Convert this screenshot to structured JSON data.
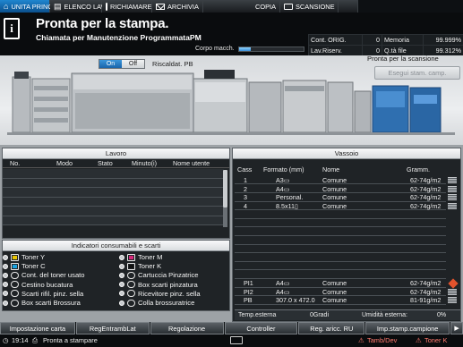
{
  "tabs": [
    {
      "label": "UNITA PRINC.",
      "icon": "home-icon",
      "active": true
    },
    {
      "label": "ELENCO LAV.",
      "icon": "job-list-icon"
    },
    {
      "label": "RICHIAMARE",
      "icon": "recall-icon"
    },
    {
      "label": "ARCHIVIA",
      "icon": "store-icon"
    },
    {
      "label": "COPIA",
      "icon": "copy-icon"
    },
    {
      "label": "SCANSIONE",
      "icon": "scan-icon"
    }
  ],
  "header": {
    "status": "Pronta per la stampa.",
    "substatus": "Chiamata per Manutenzione ProgrammataPM",
    "body_label": "Corpo macch.",
    "body_level": 0.18,
    "counters": [
      {
        "label": "Cont. ORIG.",
        "value": "0",
        "label2": "Memoria",
        "value2": "99.999%"
      },
      {
        "label": "Lav.Riserv.",
        "value": "0",
        "label2": "Q.tà file",
        "value2": "99.312%"
      }
    ]
  },
  "illustration": {
    "toggle_on": "On",
    "toggle_off": "Off",
    "heat_label": "Riscaldat. PB",
    "scan_ready": "Pronta per la scansione",
    "print_samples": "Esegui stam. camp."
  },
  "jobs": {
    "title": "Lavoro",
    "columns": [
      "No.",
      "Modo",
      "Stato",
      "Minuto(i)",
      "Nome utente"
    ],
    "rows": 6
  },
  "consumables": {
    "title": "Indicatori consumabili e scarti",
    "left": [
      {
        "label": "Toner Y",
        "icon": "toner-y-icon",
        "color": "#e8c400"
      },
      {
        "label": "Toner C",
        "icon": "toner-c-icon",
        "color": "#1aa3e0"
      },
      {
        "label": "Cont. del toner usato",
        "icon": "waste-toner-icon"
      },
      {
        "label": "Cestino bucatura",
        "icon": "punch-bin-icon"
      },
      {
        "label": "Scarti rifil. pinz. sella",
        "icon": "trim-waste-icon"
      },
      {
        "label": "Box scarti Brossura",
        "icon": "binding-waste-icon"
      }
    ],
    "right": [
      {
        "label": "Toner M",
        "icon": "toner-m-icon",
        "color": "#d6267a"
      },
      {
        "label": "Toner K",
        "icon": "toner-k-icon",
        "color": "#111111"
      },
      {
        "label": "Cartuccia Pinzatrice",
        "icon": "staple-cartridge-icon"
      },
      {
        "label": "Box scarti pinzatura",
        "icon": "staple-waste-icon"
      },
      {
        "label": "Ricevitore pinz. sella",
        "icon": "saddle-staple-icon"
      },
      {
        "label": "Colla brossuratrice",
        "icon": "glue-icon"
      }
    ]
  },
  "trays": {
    "title": "Vassoio",
    "columns": [
      "Cass",
      "Formato (mm)",
      "Nome",
      "Gramm."
    ],
    "rows": [
      {
        "cass": "1",
        "format": "A3▭",
        "name": "Comune",
        "weight": "62-74g/m2",
        "level": 0.9
      },
      {
        "cass": "2",
        "format": "A4▭",
        "name": "Comune",
        "weight": "62-74g/m2",
        "level": 0.9
      },
      {
        "cass": "3",
        "format": "Personal.",
        "name": "Comune",
        "weight": "62-74g/m2",
        "level": 0.9
      },
      {
        "cass": "4",
        "format": "8.5x11▯",
        "name": "Comune",
        "weight": "62-74g/m2",
        "level": 0.9
      },
      {
        "cass": "",
        "format": "",
        "name": "",
        "weight": ""
      },
      {
        "cass": "",
        "format": "",
        "name": "",
        "weight": ""
      },
      {
        "cass": "",
        "format": "",
        "name": "",
        "weight": ""
      },
      {
        "cass": "",
        "format": "",
        "name": "",
        "weight": ""
      },
      {
        "cass": "",
        "format": "",
        "name": "",
        "weight": ""
      },
      {
        "cass": "",
        "format": "",
        "name": "",
        "weight": ""
      },
      {
        "cass": "",
        "format": "",
        "name": "",
        "weight": ""
      },
      {
        "cass": "",
        "format": "",
        "name": "",
        "weight": ""
      },
      {
        "cass": "PI1",
        "format": "A4▭",
        "name": "Comune",
        "weight": "62-74g/m2",
        "status": "warning"
      },
      {
        "cass": "PI2",
        "format": "A4▭",
        "name": "Comune",
        "weight": "62-74g/m2",
        "level": 0.9
      },
      {
        "cass": "PB",
        "format": "307.0 x 472.0",
        "name": "Comune",
        "weight": "81-91g/m2",
        "level": 0.9
      }
    ],
    "temp_label": "Temp.esterna",
    "temp_value": "0Gradi",
    "humidity_label": "Umidità esterna:",
    "humidity_value": "0%"
  },
  "buttons": [
    "Impostazione carta",
    "RegEntrambLat",
    "Regolazione",
    "Controller",
    "Reg. aricc. RU",
    "Imp.stamp.campione"
  ],
  "statusbar": {
    "time": "19:14",
    "message": "Pronta a stampare",
    "tamb": "Tamb/Dev",
    "toner": "Toner K"
  },
  "colors": {
    "accent": "#1a6fbf",
    "warning": "#e2532d"
  }
}
